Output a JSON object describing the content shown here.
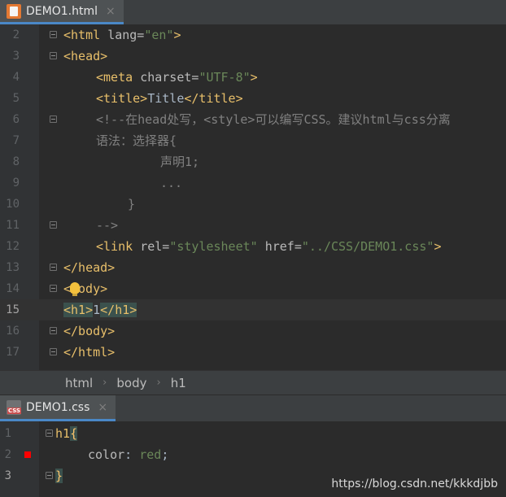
{
  "html_tab": {
    "label": "DEMO1.html",
    "close": "×"
  },
  "html_lines": [
    {
      "num": "2"
    },
    {
      "num": "3"
    },
    {
      "num": "4"
    },
    {
      "num": "5"
    },
    {
      "num": "6"
    },
    {
      "num": "7"
    },
    {
      "num": "8"
    },
    {
      "num": "9"
    },
    {
      "num": "10"
    },
    {
      "num": "11"
    },
    {
      "num": "12"
    },
    {
      "num": "13"
    },
    {
      "num": "14"
    },
    {
      "num": "15"
    },
    {
      "num": "16"
    },
    {
      "num": "17"
    }
  ],
  "code": {
    "l2a": "<html ",
    "l2b": "lang=",
    "l2c": "\"en\"",
    "l2d": ">",
    "l3": "<head>",
    "l4a": "<meta ",
    "l4b": "charset=",
    "l4c": "\"UTF-8\"",
    "l4d": ">",
    "l5a": "<title>",
    "l5b": "Title",
    "l5c": "</title>",
    "l6": "<!--在head处写，<style>可以编写CSS。建议html与css分离",
    "l7": "语法：选择器{",
    "l8": "声明1;",
    "l9": "...",
    "l10": "}",
    "l11": "-->",
    "l12a": "<link ",
    "l12b": "rel=",
    "l12c": "\"stylesheet\" ",
    "l12d": "href=",
    "l12e": "\"../CSS/DEMO1.css\"",
    "l12f": ">",
    "l13": "</head>",
    "l14a": "<",
    "l14b": "ody>",
    "l15a": "<h1>",
    "l15b": "1",
    "l15c": "</h1>",
    "l16": "</body>",
    "l17": "</html>"
  },
  "breadcrumb": [
    "html",
    "body",
    "h1"
  ],
  "breadcrumb_sep": "›",
  "css_tab": {
    "label": "DEMO1.css",
    "close": "×"
  },
  "css_lines": [
    {
      "num": "1"
    },
    {
      "num": "2"
    },
    {
      "num": "3"
    }
  ],
  "css_code": {
    "l1a": "h1",
    "l1b": "{",
    "l2a": "color",
    "l2b": ": ",
    "l2c": "red",
    "l2d": ";",
    "l3": "}"
  },
  "watermark": "https://blog.csdn.net/kkkdjbb",
  "colors": {
    "background": "#2b2b2b",
    "tag": "#e8bf6a",
    "string": "#6a8759",
    "comment": "#808080",
    "breakpoint": "#ff0000"
  }
}
